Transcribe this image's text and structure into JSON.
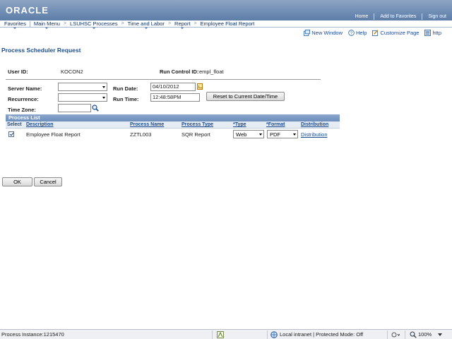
{
  "header": {
    "logo_text": "ORACLE",
    "links": [
      "Home",
      "Add to Favorites",
      "Sign out"
    ]
  },
  "nav": {
    "items": [
      "Favorites",
      "Main Menu",
      "LSUHSC Processes",
      "Time and Labor",
      "Report",
      "Employee Float Report"
    ]
  },
  "toolbar": {
    "new_window": "New Window",
    "help": "Help",
    "customize_page": "Customize Page",
    "http": "http"
  },
  "page": {
    "title": "Process Scheduler Request"
  },
  "form": {
    "user_id_label": "User ID:",
    "user_id_value": "KOCON2",
    "run_control_label": "Run Control ID:",
    "run_control_value": "empl_float",
    "server_name_label": "Server Name:",
    "server_name_value": "",
    "recurrence_label": "Recurrence:",
    "recurrence_value": "",
    "time_zone_label": "Time Zone:",
    "time_zone_value": "",
    "run_date_label": "Run Date:",
    "run_date_value": "04/10/2012",
    "run_time_label": "Run Time:",
    "run_time_value": "12:48:58PM",
    "reset_button": "Reset to Current Date/Time"
  },
  "process_list": {
    "title": "Process List",
    "columns": [
      "Select",
      "Description",
      "Process Name",
      "Process Type",
      "*Type",
      "*Format",
      "Distribution"
    ],
    "rows": [
      {
        "selected": true,
        "description": "Employee Float Report",
        "process_name": "ZZTL003",
        "process_type": "SQR Report",
        "type": "Web",
        "format": "PDF",
        "distribution": "Distribution"
      }
    ]
  },
  "buttons": {
    "ok": "OK",
    "cancel": "Cancel"
  },
  "statusbar": {
    "left": "Process Instance:1215470",
    "zone": "Local intranet | Protected Mode: Off",
    "zoom": "100%"
  },
  "colors": {
    "header_blue": "#6f8cb3",
    "title_blue": "#1e4e8c",
    "link_blue": "#1a4a8c"
  }
}
